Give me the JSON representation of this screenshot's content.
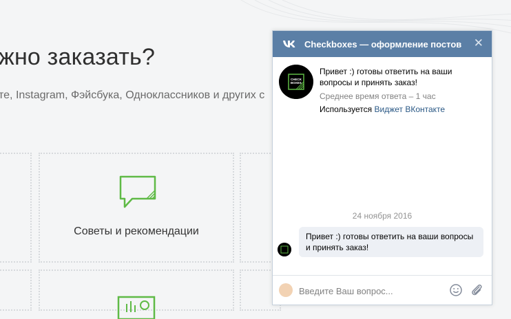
{
  "page": {
    "heading": "жно заказать?",
    "subtitle": "те, Instagram, Фэйсбука, Одноклассников и других с",
    "cards": [
      {
        "label": "Советы и рекомендации",
        "icon": "speech-bubble-icon"
      }
    ],
    "accent_color": "#5fba46"
  },
  "widget": {
    "title": "Checkboxes — оформление постов",
    "close_label": "✕",
    "header_color": "#5b7fa6",
    "avatar_text": [
      "CHECK",
      "BOXES"
    ],
    "greeting": "Привет :) готовы ответить на ваши вопросы и принять заказ!",
    "response_time": "Среднее время ответа – 1 час",
    "used_prefix": "Используется",
    "used_link": "Виджет ВКонтакте",
    "chat_date": "24 ноября 2016",
    "message": "Привет :) готовы ответить на ваши вопросы и принять заказ!",
    "input_placeholder": "Введите Ваш вопрос..."
  }
}
